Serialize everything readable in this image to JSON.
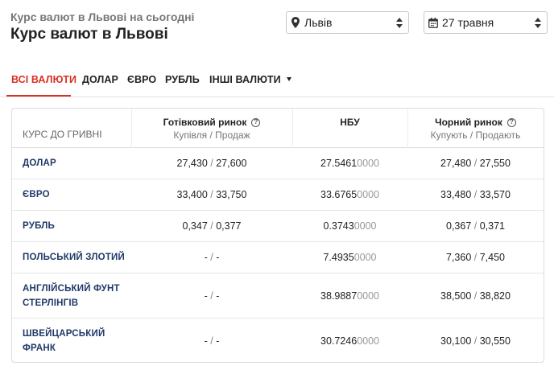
{
  "header": {
    "subtitle": "Курс валют в Львові на сьогодні",
    "title": "Курс валют в Львові"
  },
  "city_select": {
    "icon": "map-pin-icon",
    "value": "Львів"
  },
  "date_select": {
    "icon": "calendar-icon",
    "value": "27 травня"
  },
  "tabs": [
    {
      "label": "ВСІ ВАЛЮТИ",
      "active": true
    },
    {
      "label": "ДОЛАР",
      "active": false
    },
    {
      "label": "ЄВРО",
      "active": false
    },
    {
      "label": "РУБЛЬ",
      "active": false
    },
    {
      "label": "ІНШІ ВАЛЮТИ",
      "active": false,
      "dropdown": true
    }
  ],
  "colors": {
    "accent": "#d93025",
    "currency_name": "#1f3a68"
  },
  "table": {
    "row_header": "КУРС ДО ГРИВНІ",
    "columns": [
      {
        "title": "Готівковий ринок",
        "subtitle": "Купівля / Продаж",
        "help": "?"
      },
      {
        "title": "НБУ",
        "subtitle": ""
      },
      {
        "title": "Чорний ринок",
        "subtitle": "Купують / Продають",
        "help": "?"
      }
    ],
    "rows": [
      {
        "name": "ДОЛАР",
        "cash_buy": "27,430",
        "cash_sell": "27,600",
        "nbu_main": "27.5461",
        "nbu_tail": "0000",
        "black_buy": "27,480",
        "black_sell": "27,550"
      },
      {
        "name": "ЄВРО",
        "cash_buy": "33,400",
        "cash_sell": "33,750",
        "nbu_main": "33.6765",
        "nbu_tail": "0000",
        "black_buy": "33,480",
        "black_sell": "33,570"
      },
      {
        "name": "РУБЛЬ",
        "cash_buy": "0,347",
        "cash_sell": "0,377",
        "nbu_main": "0.3743",
        "nbu_tail": "0000",
        "black_buy": "0,367",
        "black_sell": "0,371"
      },
      {
        "name": "ПОЛЬСЬКИЙ ЗЛОТИЙ",
        "cash_buy": "-",
        "cash_sell": "-",
        "nbu_main": "7.4935",
        "nbu_tail": "0000",
        "black_buy": "7,360",
        "black_sell": "7,450"
      },
      {
        "name": "АНГЛІЙСЬКИЙ ФУНТ СТЕРЛІНГІВ",
        "cash_buy": "-",
        "cash_sell": "-",
        "nbu_main": "38.9887",
        "nbu_tail": "0000",
        "black_buy": "38,500",
        "black_sell": "38,820"
      },
      {
        "name": "ШВЕЙЦАРСЬКИЙ ФРАНК",
        "cash_buy": "-",
        "cash_sell": "-",
        "nbu_main": "30.7246",
        "nbu_tail": "0000",
        "black_buy": "30,100",
        "black_sell": "30,550"
      }
    ]
  }
}
